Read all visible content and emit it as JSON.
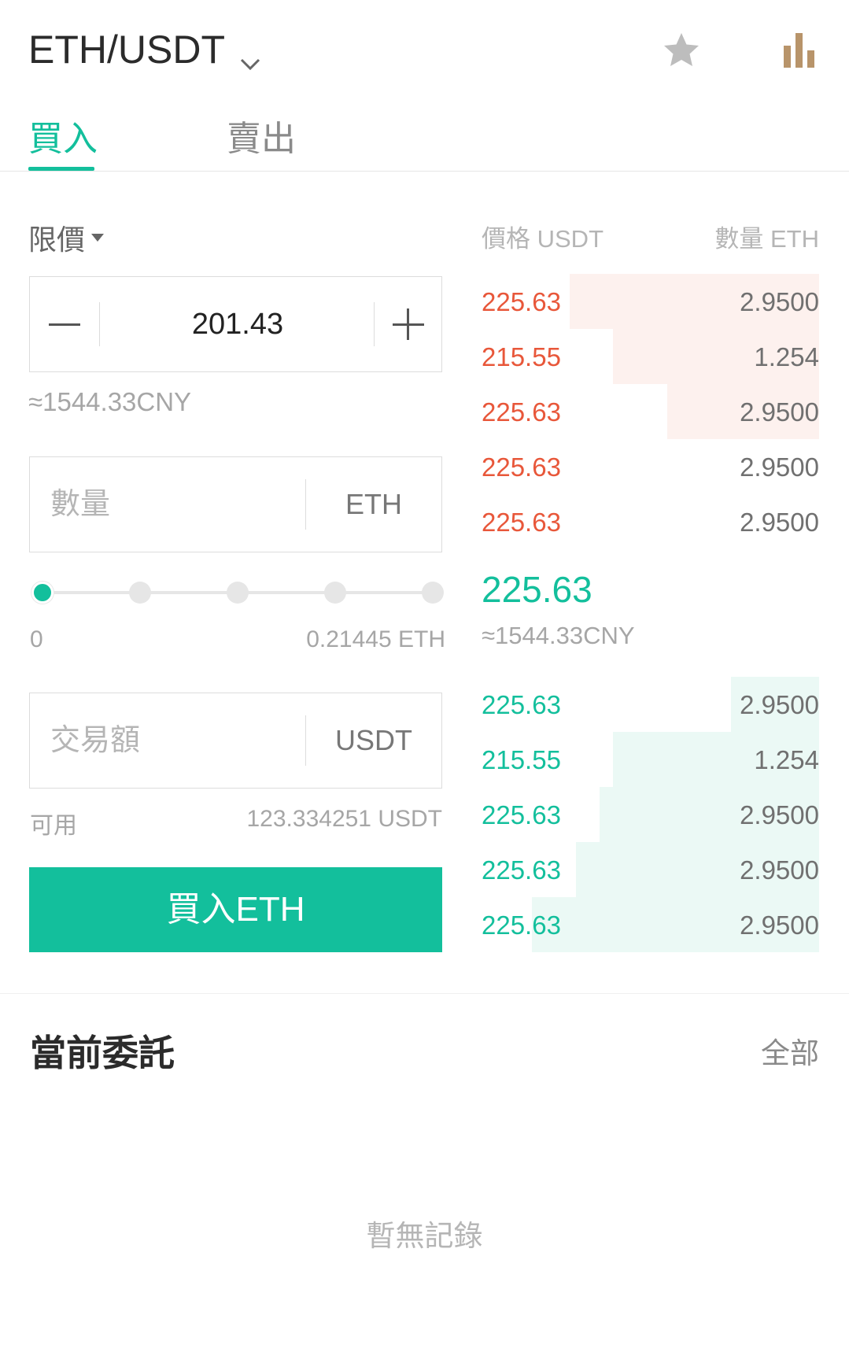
{
  "header": {
    "pair": "ETH/USDT",
    "icons": {
      "dropdown": "chevron-down-icon",
      "favorite": "star-icon",
      "chart": "bar-chart-icon"
    },
    "colors": {
      "favorite": "#bdbdbd",
      "chart": "#b8946a"
    }
  },
  "tabs": [
    {
      "label": "買入",
      "active": true
    },
    {
      "label": "賣出",
      "active": false
    }
  ],
  "colors": {
    "accent": "#13bf9c",
    "ask": "#e8573a",
    "bid": "#13bf9c"
  },
  "form": {
    "order_type": "限價",
    "price": {
      "value": "201.43"
    },
    "price_cny": "≈1544.33CNY",
    "amount": {
      "placeholder": "數量",
      "unit": "ETH"
    },
    "slider": {
      "min_label": "0",
      "max_label": "0.21445 ETH",
      "level": 0,
      "steps": 5
    },
    "total": {
      "placeholder": "交易額",
      "unit": "USDT"
    },
    "available": {
      "label": "可用",
      "value": "123.334251 USDT"
    },
    "submit_label": "買入ETH"
  },
  "orderbook": {
    "price_header": "價格 USDT",
    "qty_header": "數量 ETH",
    "asks": [
      {
        "price": "225.63",
        "qty": "2.9500",
        "depth": 0.74
      },
      {
        "price": "215.55",
        "qty": "1.254",
        "depth": 0.61
      },
      {
        "price": "225.63",
        "qty": "2.9500",
        "depth": 0.45
      },
      {
        "price": "225.63",
        "qty": "2.9500",
        "depth": 0
      },
      {
        "price": "225.63",
        "qty": "2.9500",
        "depth": 0
      }
    ],
    "last_price": "225.63",
    "last_price_cny": "≈1544.33CNY",
    "bids": [
      {
        "price": "225.63",
        "qty": "2.9500",
        "depth": 0.26
      },
      {
        "price": "215.55",
        "qty": "1.254",
        "depth": 0.61
      },
      {
        "price": "225.63",
        "qty": "2.9500",
        "depth": 0.65
      },
      {
        "price": "225.63",
        "qty": "2.9500",
        "depth": 0.72
      },
      {
        "price": "225.63",
        "qty": "2.9500",
        "depth": 0.85
      }
    ]
  },
  "orders": {
    "title": "當前委託",
    "all_label": "全部",
    "empty_text": "暫無記錄"
  }
}
